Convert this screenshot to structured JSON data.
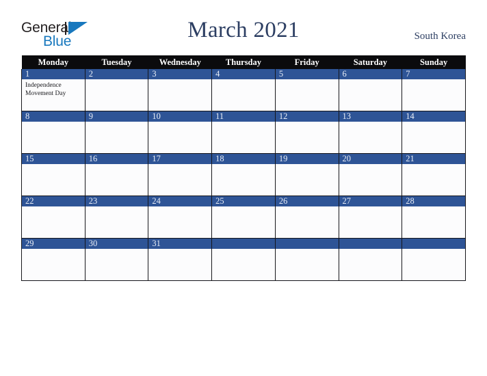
{
  "brand": {
    "name_part1": "General",
    "name_part2": "Blue",
    "mark": "triangle-logo"
  },
  "header": {
    "title": "March 2021",
    "country": "South Korea"
  },
  "colors": {
    "date_band": "#2E5496",
    "header_row": "#0B0B0D",
    "title_text": "#2C3E62",
    "brand_blue": "#1878BE",
    "cell_bg": "#FCFCFD",
    "grid_border": "#15151A"
  },
  "calendar": {
    "weekday_headers": [
      "Monday",
      "Tuesday",
      "Wednesday",
      "Thursday",
      "Friday",
      "Saturday",
      "Sunday"
    ],
    "weeks": [
      [
        {
          "date": "1",
          "events": [
            "Independence",
            "Movement Day"
          ]
        },
        {
          "date": "2",
          "events": []
        },
        {
          "date": "3",
          "events": []
        },
        {
          "date": "4",
          "events": []
        },
        {
          "date": "5",
          "events": []
        },
        {
          "date": "6",
          "events": []
        },
        {
          "date": "7",
          "events": []
        }
      ],
      [
        {
          "date": "8",
          "events": []
        },
        {
          "date": "9",
          "events": []
        },
        {
          "date": "10",
          "events": []
        },
        {
          "date": "11",
          "events": []
        },
        {
          "date": "12",
          "events": []
        },
        {
          "date": "13",
          "events": []
        },
        {
          "date": "14",
          "events": []
        }
      ],
      [
        {
          "date": "15",
          "events": []
        },
        {
          "date": "16",
          "events": []
        },
        {
          "date": "17",
          "events": []
        },
        {
          "date": "18",
          "events": []
        },
        {
          "date": "19",
          "events": []
        },
        {
          "date": "20",
          "events": []
        },
        {
          "date": "21",
          "events": []
        }
      ],
      [
        {
          "date": "22",
          "events": []
        },
        {
          "date": "23",
          "events": []
        },
        {
          "date": "24",
          "events": []
        },
        {
          "date": "25",
          "events": []
        },
        {
          "date": "26",
          "events": []
        },
        {
          "date": "27",
          "events": []
        },
        {
          "date": "28",
          "events": []
        }
      ],
      [
        {
          "date": "29",
          "events": []
        },
        {
          "date": "30",
          "events": []
        },
        {
          "date": "31",
          "events": []
        },
        {
          "date": "",
          "events": []
        },
        {
          "date": "",
          "events": []
        },
        {
          "date": "",
          "events": []
        },
        {
          "date": "",
          "events": []
        }
      ]
    ]
  }
}
